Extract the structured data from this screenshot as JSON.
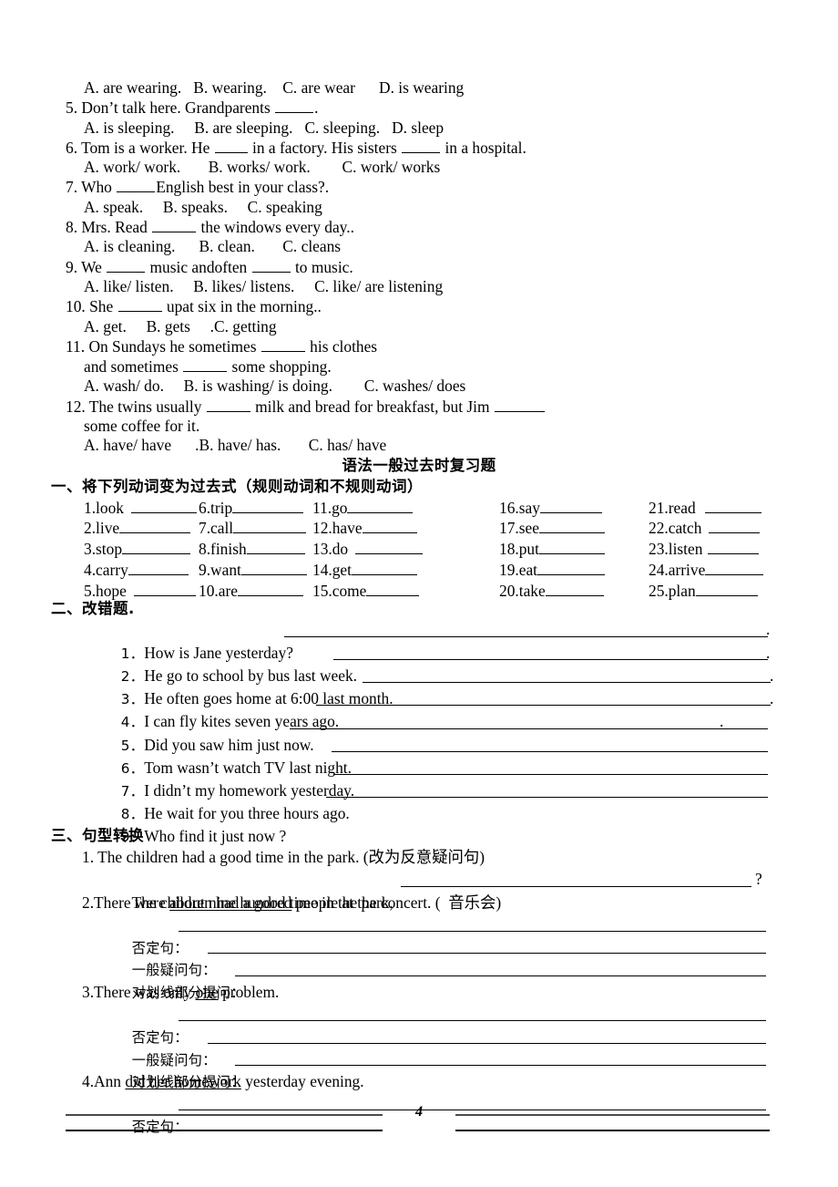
{
  "document": {
    "page_number": "4"
  },
  "multiple_choice": {
    "items": [
      {
        "id": "q4-options",
        "text": "A. are wearing.   B. wearing.    C. are wear      D. is wearing"
      },
      {
        "id": "q5-stem-a",
        "text": "5. Don’t talk here. Grandparents "
      },
      {
        "id": "q5-stem-b",
        "text": "."
      },
      {
        "id": "q5-options",
        "text": "A. is sleeping.     B. are sleeping.   C. sleeping.   D. sleep"
      },
      {
        "id": "q6-stem-a",
        "text": "6. Tom is a worker. He "
      },
      {
        "id": "q6-stem-b",
        "text": " in a factory. His sisters "
      },
      {
        "id": "q6-stem-c",
        "text": " in a hospital."
      },
      {
        "id": "q6-options",
        "text": "A. work/ work.       B. works/ work.        C. work/ works"
      },
      {
        "id": "q7-stem-a",
        "text": "7. Who "
      },
      {
        "id": "q7-stem-b",
        "text": "English best in your class?."
      },
      {
        "id": "q7-options",
        "text": "A. speak.     B. speaks.     C. speaking"
      },
      {
        "id": "q8-stem-a",
        "text": "8. Mrs. Read "
      },
      {
        "id": "q8-stem-b",
        "text": " the windows every day.."
      },
      {
        "id": "q8-options",
        "text": "A. is cleaning.      B. clean.       C. cleans"
      },
      {
        "id": "q9-stem-a",
        "text": "9. We "
      },
      {
        "id": "q9-stem-b",
        "text": " music andoften "
      },
      {
        "id": "q9-stem-c",
        "text": " to music."
      },
      {
        "id": "q9-options",
        "text": "A. like/ listen.     B. likes/ listens.     C. like/ are listening"
      },
      {
        "id": "q10-stem-a",
        "text": "10. She "
      },
      {
        "id": "q10-stem-b",
        "text": " upat six in the morning.."
      },
      {
        "id": "q10-options",
        "text": "A. get.     B. gets     .C. getting"
      },
      {
        "id": "q11-stem-a",
        "text": "11. On Sundays he sometimes "
      },
      {
        "id": "q11-stem-b",
        "text": " his clothes"
      },
      {
        "id": "q11-stem-c",
        "text": "and sometimes "
      },
      {
        "id": "q11-stem-d",
        "text": " some shopping."
      },
      {
        "id": "q11-options",
        "text": "A. wash/ do.     B. is washing/ is doing.        C. washes/ does"
      },
      {
        "id": "q12-stem-a",
        "text": "12. The twins usually "
      },
      {
        "id": "q12-stem-b",
        "text": " milk and bread for breakfast, but Jim "
      },
      {
        "id": "q12-stem-c",
        "text": "some coffee for it."
      },
      {
        "id": "q12-options",
        "text": "A. have/ have      .B. have/ has.       C. has/ have"
      }
    ]
  },
  "main_title": "语法一般过去时复习题",
  "section_one": {
    "heading": "一、将下列动词变为过去式（规则动词和不规则动词）",
    "columns": [
      {
        "items": [
          "1.look",
          "2.live",
          "3.stop",
          "4.carry",
          "5.hope"
        ]
      },
      {
        "items": [
          "6.trip",
          "7.call",
          "8.finish",
          "9.want",
          "10.are"
        ]
      },
      {
        "items": [
          "11.go",
          "12.have",
          "13.do",
          "14.get",
          "15.come"
        ]
      },
      {
        "items": [
          "16.say",
          "17.see",
          "18.put",
          "19.eat",
          "20.take"
        ]
      },
      {
        "items": [
          "21.read",
          "22.catch",
          "23.listen",
          "24.arrive",
          "25.plan"
        ]
      }
    ]
  },
  "section_two": {
    "heading": "二、改错题.",
    "items": [
      {
        "num": "1．",
        "text": "How is Jane yesterday?",
        "trailing": "."
      },
      {
        "num": "2．",
        "text": "He go to school by bus last week.",
        "trailing": "."
      },
      {
        "num": "3．",
        "text": "He often goes home at 6:00 last month.",
        "trailing": "."
      },
      {
        "num": "4．",
        "text": "I can fly kites seven years ago.",
        "trailing": "."
      },
      {
        "num": "5．",
        "text": "Did you saw him just now.",
        "trailing": "."
      },
      {
        "num": "6．",
        "text": "Tom wasn’t watch TV last night.",
        "trailing": ""
      },
      {
        "num": "7．",
        "text": "I didn’t my homework yesterday.",
        "trailing": ""
      },
      {
        "num": "8．",
        "text": "He wait for you three hours ago.",
        "trailing": ""
      },
      {
        "num": "9．",
        "text": "Who find it just now ?",
        "trailing": ""
      }
    ]
  },
  "section_three": {
    "heading": "三、句型转换",
    "q1": {
      "line1": "1. The children had a good time in the park. (改为反意疑问句)",
      "line2": "The children had a good time in the park,",
      "line2_end": "?"
    },
    "q2": {
      "prefix": "2.There were ",
      "underlined": "about nine hundred",
      "suffix": " people at the concert. (  音乐会)",
      "labels": [
        "否定句：",
        "一般疑问句：",
        "对划线部分提问："
      ]
    },
    "q3": {
      "prefix": "3.There was only ",
      "underlined": "one",
      "suffix": " problem.",
      "labels": [
        "否定句：",
        "一般疑问句：",
        "对划线部分提问："
      ]
    },
    "q4": {
      "prefix": "4.Ann ",
      "underlined": "did her homework",
      "suffix": " yesterday evening.",
      "labels": [
        "否定句："
      ]
    }
  }
}
